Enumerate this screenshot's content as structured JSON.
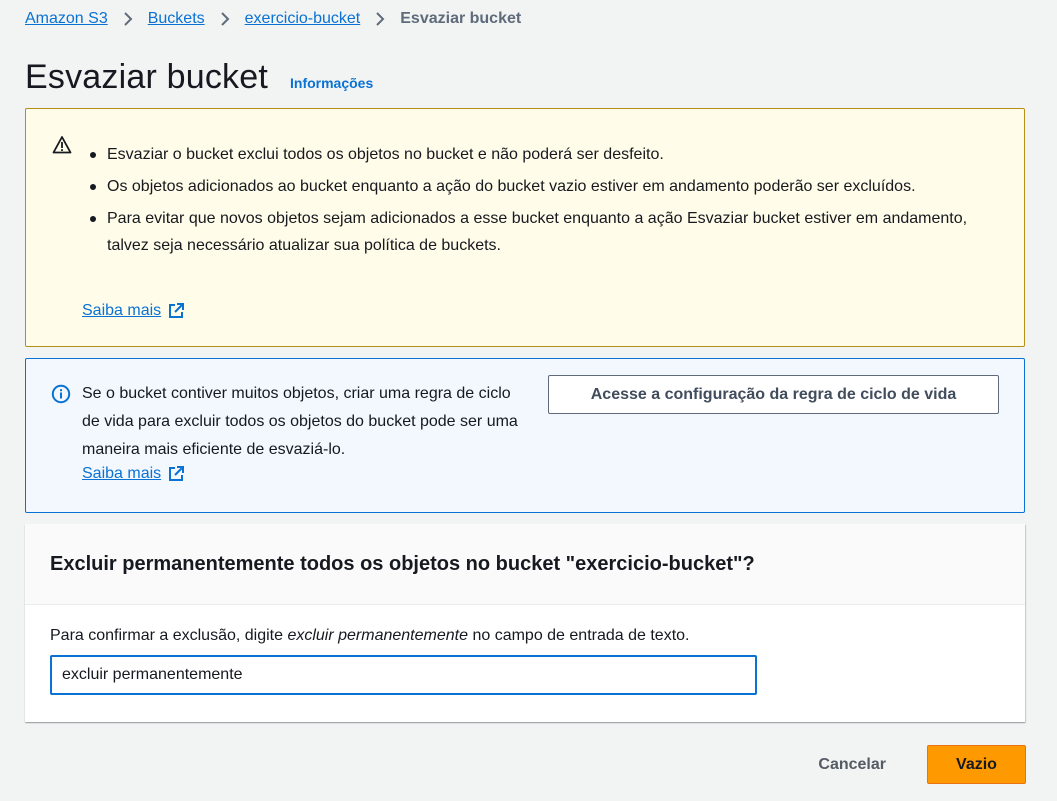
{
  "breadcrumb": {
    "items": [
      "Amazon S3",
      "Buckets",
      "exercicio-bucket"
    ],
    "current": "Esvaziar bucket"
  },
  "header": {
    "title": "Esvaziar bucket",
    "info_link": "Informações"
  },
  "warning_alert": {
    "bullets": [
      "Esvaziar o bucket exclui todos os objetos no bucket e não poderá ser desfeito.",
      "Os objetos adicionados ao bucket enquanto a ação do bucket vazio estiver em andamento poderão ser excluídos.",
      "Para evitar que novos objetos sejam adicionados a esse bucket enquanto a ação Esvaziar bucket estiver em andamento, talvez seja necessário atualizar sua política de buckets."
    ],
    "learn_more": "Saiba mais"
  },
  "info_alert": {
    "text": "Se o bucket contiver muitos objetos, criar uma regra de ciclo de vida para excluir todos os objetos do bucket pode ser uma maneira mais eficiente de esvaziá-lo.",
    "learn_more": "Saiba mais",
    "button_label": "Acesse a configuração da regra de ciclo de vida"
  },
  "confirm": {
    "heading": "Excluir permanentemente todos os objetos no bucket \"exercicio-bucket\"?",
    "desc_before": "Para confirmar a exclusão, digite ",
    "desc_emphasis": "excluir permanentemente",
    "desc_after": " no campo de entrada de texto.",
    "input_value": "excluir permanentemente"
  },
  "actions": {
    "cancel_label": "Cancelar",
    "submit_label": "Vazio"
  },
  "colors": {
    "link": "#0972d3",
    "warning_bg": "#fffce9",
    "warning_border": "#b49116",
    "info_bg": "#f2f8fd",
    "primary_button": "#ff9900"
  }
}
